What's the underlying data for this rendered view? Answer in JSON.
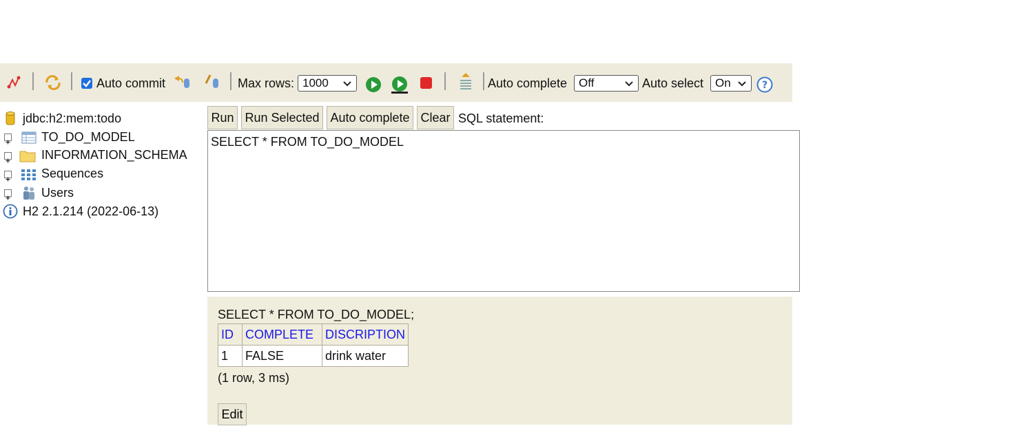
{
  "toolbar": {
    "auto_commit_label": "Auto commit",
    "auto_commit_checked": true,
    "max_rows_label": "Max rows:",
    "max_rows_value": "1000",
    "auto_complete_label": "Auto complete",
    "auto_complete_value": "Off",
    "auto_select_label": "Auto select",
    "auto_select_value": "On"
  },
  "tree": {
    "connection": "jdbc:h2:mem:todo",
    "items": [
      {
        "label": "TO_DO_MODEL",
        "icon": "table-icon"
      },
      {
        "label": "INFORMATION_SCHEMA",
        "icon": "folder-icon"
      },
      {
        "label": "Sequences",
        "icon": "sequences-icon"
      },
      {
        "label": "Users",
        "icon": "users-icon"
      }
    ],
    "version": "H2 2.1.214 (2022-06-13)"
  },
  "editor": {
    "run_label": "Run",
    "run_selected_label": "Run Selected",
    "auto_complete_label": "Auto complete",
    "clear_label": "Clear",
    "sql_statement_label": "SQL statement:",
    "sql_text": "SELECT * FROM TO_DO_MODEL"
  },
  "results": {
    "query": "SELECT * FROM TO_DO_MODEL;",
    "columns": [
      "ID",
      "COMPLETE",
      "DISCRIPTION"
    ],
    "rows": [
      [
        "1",
        "FALSE",
        "drink water"
      ]
    ],
    "summary": "(1 row, 3 ms)",
    "edit_label": "Edit"
  },
  "colors": {
    "toolbar_bg": "#eeebdd",
    "results_bg": "#f1eddd",
    "header_link": "#1818e8"
  }
}
